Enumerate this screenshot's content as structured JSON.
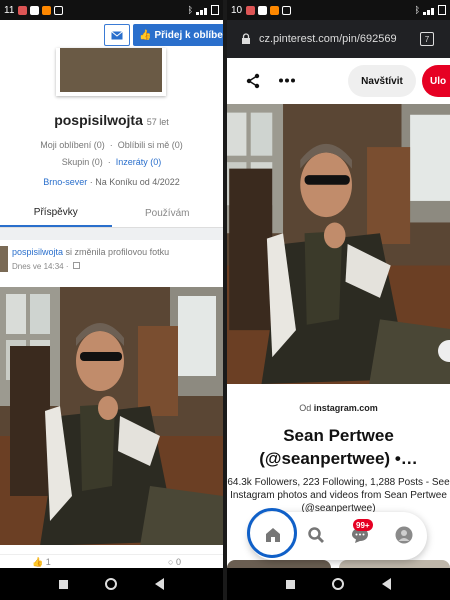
{
  "left": {
    "status": {
      "time": "11"
    },
    "buttons": {
      "favorite_label": "Přidej k oblíben"
    },
    "profile": {
      "username": "pospisilwojta",
      "age": "57 let",
      "stats_row1": [
        "Moji oblíbení (0)",
        "Oblíbili si mě (0)"
      ],
      "stats_row2_a": "Skupin (0)",
      "stats_row2_b": "Inzeráty (0)",
      "location": "Brno-sever",
      "since": "· Na Koníku od 4/2022"
    },
    "tabs": [
      "Příspěvky",
      "Používám"
    ],
    "post": {
      "author": "pospisilwojta",
      "action": "si změnila profilovou fotku",
      "date": "Dnes ve 14:34 ·"
    },
    "actions": {
      "likes": "1",
      "comments": "0"
    }
  },
  "right": {
    "status": {
      "time": "10"
    },
    "url": "cz.pinterest.com/pin/692569",
    "tab_count": "7",
    "buttons": {
      "visit": "Navštívit",
      "save": "Ulo"
    },
    "source_prefix": "Od",
    "source": "instagram.com",
    "title": "Sean Pertwee (@seanpertwee) •…",
    "description": "64.3k Followers, 223 Following, 1,288 Posts - See Instagram photos and videos from Sean Pertwee (@seanpertwee)",
    "notif_badge": "99+"
  },
  "colors": {
    "link_blue": "#2a6fcc",
    "pinterest_red": "#e60023",
    "home_ring": "#1060c8"
  }
}
